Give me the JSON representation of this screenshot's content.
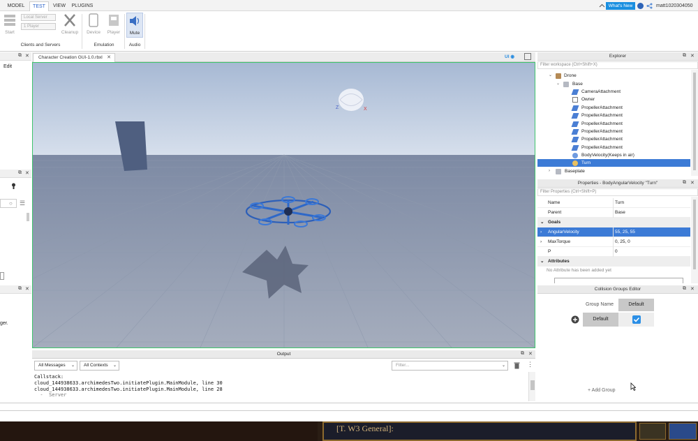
{
  "menubar": {
    "tabs": [
      "MODEL",
      "TEST",
      "VIEW",
      "PLUGINS"
    ],
    "active_tab": "TEST",
    "whats_new": "What's New",
    "username": "matt1020304050"
  },
  "ribbon": {
    "start_label": "Start",
    "client_select": "Local Server",
    "player_select": "1 Player",
    "cleanup_label": "Cleanup",
    "device_label": "Device",
    "player_label": "Player",
    "mute_label": "Mute",
    "group_clients": "Clients and Servers",
    "group_emulation": "Emulation",
    "group_audio": "Audio"
  },
  "left": {
    "edit_label": "Edit",
    "trailing_text": "ger."
  },
  "document": {
    "tab_title": "Character Creation GUI-1.0.rbxl",
    "ui_toggle": "UI"
  },
  "explorer": {
    "title": "Explorer",
    "filter_placeholder": "Filter workspace (Ctrl+Shift+X)",
    "items": [
      {
        "label": "Drone"
      },
      {
        "label": "Base"
      },
      {
        "label": "CameraAttachment"
      },
      {
        "label": "Owner"
      },
      {
        "label": "PropellerAttachment"
      },
      {
        "label": "PropellerAttachment"
      },
      {
        "label": "PropellerAttachment"
      },
      {
        "label": "PropellerAttachment"
      },
      {
        "label": "PropellerAttachment"
      },
      {
        "label": "PropellerAttachment"
      },
      {
        "label": "BodyVelocity(Keeps in air)"
      },
      {
        "label": "Turn"
      },
      {
        "label": "Baseplate"
      }
    ]
  },
  "properties": {
    "title": "Properties - BodyAngularVelocity \"Turn\"",
    "filter_placeholder": "Filter Properties (Ctrl+Shift+P)",
    "rows": [
      {
        "name": "Name",
        "value": "Turn"
      },
      {
        "name": "Parent",
        "value": "Base"
      },
      {
        "category": "Goals"
      },
      {
        "name": "AngularVelocity",
        "value": "55, 25, 55"
      },
      {
        "name": "MaxTorque",
        "value": "0, 25, 0"
      },
      {
        "name": "P",
        "value": "0"
      },
      {
        "category": "Attributes"
      }
    ],
    "no_attributes": "No Attribute has been added yet"
  },
  "collision": {
    "title": "Collision Groups Editor",
    "group_name_label": "Group Name",
    "column_header": "Default",
    "row_name": "Default",
    "add_group": "+ Add Group"
  },
  "output": {
    "title": "Output",
    "messages_filter": "All Messages",
    "contexts_filter": "All Contexts",
    "search_placeholder": "Filter...",
    "lines": [
      "Callstack:",
      "cloud_144938633.archimedesTwo.initiatePlugin.MainModule, line 30",
      "cloud_144938633.archimedesTwo.initiatePlugin.MainModule, line 28",
      "  -  Server"
    ]
  },
  "taskbar": {
    "banner_text": "[T. W3 General]:"
  },
  "colors": {
    "accent": "#3c7bd6",
    "viewport_border": "#3ec46b",
    "whats_new": "#1a8fe0"
  }
}
